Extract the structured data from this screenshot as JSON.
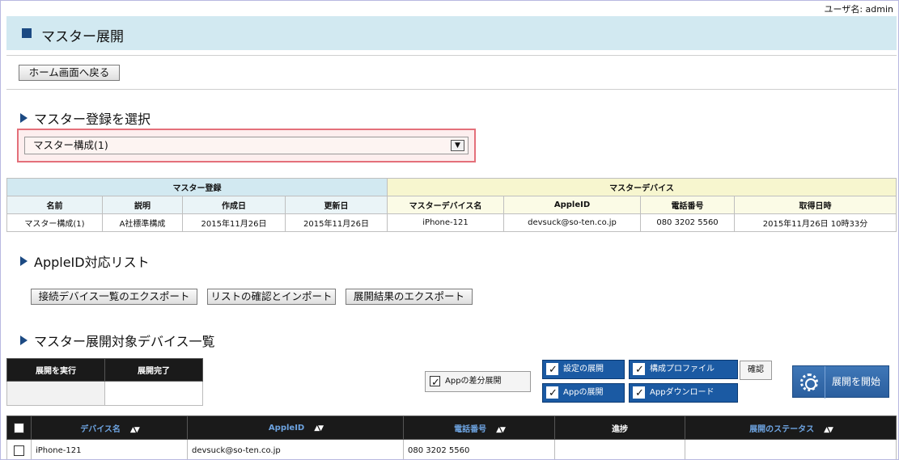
{
  "header": {
    "user_label": "ユーザ名: admin",
    "title": "マスター展開"
  },
  "toolbar": {
    "home_button": "ホーム画面へ戻る"
  },
  "master_select": {
    "section_title": "マスター登録を選択",
    "selected": "マスター構成(1)"
  },
  "master_table": {
    "group_left": "マスター登録",
    "group_right": "マスターデバイス",
    "columns": [
      "名前",
      "説明",
      "作成日",
      "更新日",
      "マスターデバイス名",
      "AppleID",
      "電話番号",
      "取得日時"
    ],
    "row": [
      "マスター構成(1)",
      "A社標準構成",
      "2015年11月26日",
      "2015年11月26日",
      "iPhone-121",
      "devsuck@so-ten.co.jp",
      "080 3202 5560",
      "2015年11月26日 10時33分"
    ]
  },
  "appleid": {
    "section_title": "AppleID対応リスト",
    "buttons": [
      "接続デバイス一覧のエクスポート",
      "リストの確認とインポート",
      "展開結果のエクスポート"
    ]
  },
  "targets": {
    "section_title": "マスター展開対象デバイス一覧",
    "exec_headers": [
      "展開を実行",
      "展開完了"
    ],
    "options": {
      "app_diff": "Appの差分展開",
      "settings": "設定の展開",
      "profile": "構成プロファイル",
      "app_deploy": "Appの展開",
      "app_download": "Appダウンロード",
      "confirm": "確認",
      "start": "展開を開始"
    },
    "device_columns": [
      "デバイス名",
      "AppleID",
      "電話番号",
      "進捗",
      "展開のステータス"
    ],
    "device_rows": [
      {
        "name": "iPhone-121",
        "appleid": "devsuck@so-ten.co.jp",
        "phone": "080 3202 5560",
        "progress": "",
        "status": ""
      }
    ]
  }
}
